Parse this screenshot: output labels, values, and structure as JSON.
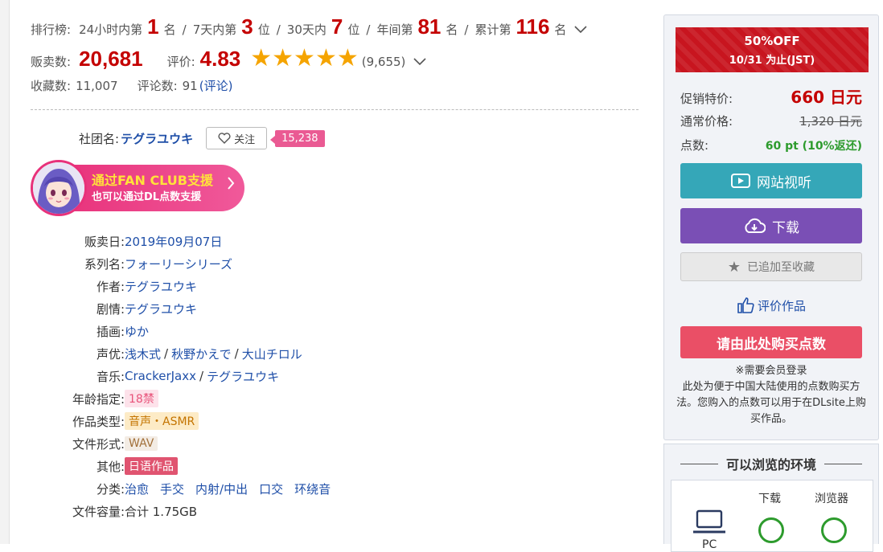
{
  "ranking": {
    "label": "排行榜:",
    "items": [
      {
        "prefix": "24小时内第",
        "value": "1",
        "suffix": "名"
      },
      {
        "prefix": "7天内第",
        "value": "3",
        "suffix": "位"
      },
      {
        "prefix": "30天内",
        "value": "7",
        "suffix": "位"
      },
      {
        "prefix": "年间第",
        "value": "81",
        "suffix": "名"
      },
      {
        "prefix": "累计第",
        "value": "116",
        "suffix": "名"
      }
    ]
  },
  "sales": {
    "label": "贩卖数:",
    "value": "20,681"
  },
  "rating": {
    "label": "评价:",
    "value": "4.83",
    "stars": 5,
    "count": "(9,655)"
  },
  "stats": {
    "fav_label": "收藏数:",
    "fav_value": "11,007",
    "review_label": "评论数:",
    "review_value": "91",
    "review_link": "(评论)"
  },
  "circle": {
    "label": "社团名:",
    "name": "テグラユウキ",
    "follow_label": "关注",
    "follower_count": "15,238"
  },
  "fanclub": {
    "line1": "通过FAN CLUB支援",
    "line2": "也可以通过DL点数支援"
  },
  "info": {
    "release": {
      "label": "贩卖日:",
      "value": "2019年09月07日"
    },
    "series": {
      "label": "系列名:",
      "value": "フォーリーシリーズ"
    },
    "author": {
      "label": "作者:",
      "value": "テグラユウキ"
    },
    "scenario": {
      "label": "剧情:",
      "value": "テグラユウキ"
    },
    "illust": {
      "label": "插画:",
      "value": "ゆか"
    },
    "voice": {
      "label": "声优:",
      "values": [
        "浅木式",
        "秋野かえで",
        "大山チロル"
      ]
    },
    "music": {
      "label": "音乐:",
      "values": [
        "CrackerJaxx",
        "テグラユウキ"
      ]
    },
    "age": {
      "label": "年龄指定:",
      "value": "18禁"
    },
    "type": {
      "label": "作品类型:",
      "value": "音声・ASMR"
    },
    "format": {
      "label": "文件形式:",
      "value": "WAV"
    },
    "other": {
      "label": "其他:",
      "value": "日语作品"
    },
    "genre": {
      "label": "分类:",
      "values": [
        "治愈",
        "手交",
        "内射/中出",
        "口交",
        "环绕音"
      ]
    },
    "size": {
      "label": "文件容量:",
      "value": "合计 1.75GB"
    }
  },
  "purchase": {
    "sale_line1": "50%OFF",
    "sale_line2": "10/31 为止(JST)",
    "promo_label": "促销特价:",
    "promo_price": "660",
    "promo_unit": "日元",
    "regular_label": "通常价格:",
    "regular_price": "1,320",
    "regular_unit": "日元",
    "points_label": "点数:",
    "points_value": "60 pt (10%返还)",
    "view_label": "网站视听",
    "download_label": "下载",
    "favorited_label": "已追加至收藏",
    "review_label": "评价作品",
    "buy_points_label": "请由此处购买点数",
    "note_title": "※需要会员登录",
    "note_body": "此处为便于中国大陆使用的点数购买方法。您购入的点数可以用于在DLsite上购买作品。"
  },
  "environment": {
    "title": "可以浏览的环境",
    "col_download": "下载",
    "col_browser": "浏览器",
    "row_pc": "PC"
  },
  "colors": {
    "accent_red": "#c40000",
    "link_blue": "#1f4fa8",
    "star": "#f5a400",
    "view_btn": "#35a7b8",
    "download_btn": "#7a4fb5",
    "buy_btn": "#ea4f66"
  }
}
